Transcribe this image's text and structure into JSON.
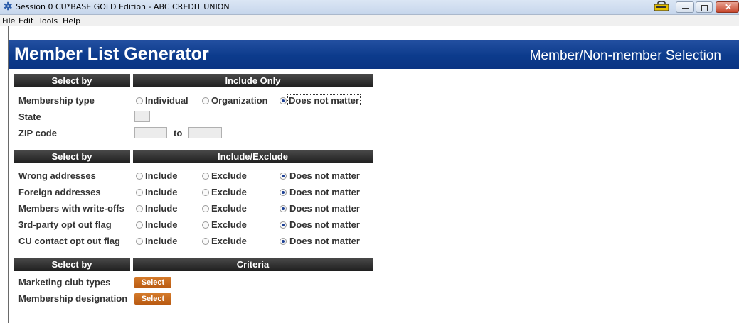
{
  "window": {
    "title": "Session 0 CU*BASE GOLD Edition - ABC CREDIT UNION",
    "app_icon": "asterisk-icon"
  },
  "menu": [
    "File",
    "Edit",
    "Tools",
    "Help"
  ],
  "header": {
    "title": "Member List Generator",
    "subtitle": "Member/Non-member Selection"
  },
  "section1": {
    "select_by": "Select by",
    "include_only": "Include Only",
    "membership_type": {
      "label": "Membership type",
      "options": [
        "Individual",
        "Organization",
        "Does not matter"
      ],
      "selected": "Does not matter"
    },
    "state": {
      "label": "State",
      "value": ""
    },
    "zip": {
      "label": "ZIP code",
      "from": "",
      "to_label": "to",
      "to": ""
    }
  },
  "section2": {
    "select_by": "Select by",
    "include_exclude": "Include/Exclude",
    "options": [
      "Include",
      "Exclude",
      "Does not matter"
    ],
    "rows": [
      {
        "label": "Wrong addresses",
        "selected": "Does not matter"
      },
      {
        "label": "Foreign addresses",
        "selected": "Does not matter"
      },
      {
        "label": "Members with write-offs",
        "selected": "Does not matter"
      },
      {
        "label": "3rd-party opt out flag",
        "selected": "Does not matter"
      },
      {
        "label": "CU contact opt out flag",
        "selected": "Does not matter"
      }
    ]
  },
  "section3": {
    "select_by": "Select by",
    "criteria": "Criteria",
    "rows": [
      {
        "label": "Marketing club types",
        "button": "Select"
      },
      {
        "label": "Membership designation",
        "button": "Select"
      }
    ]
  },
  "colors": {
    "header_blue": "#0c3b8c",
    "section_bar": "#2a2a2a",
    "select_button": "#c4651a"
  }
}
